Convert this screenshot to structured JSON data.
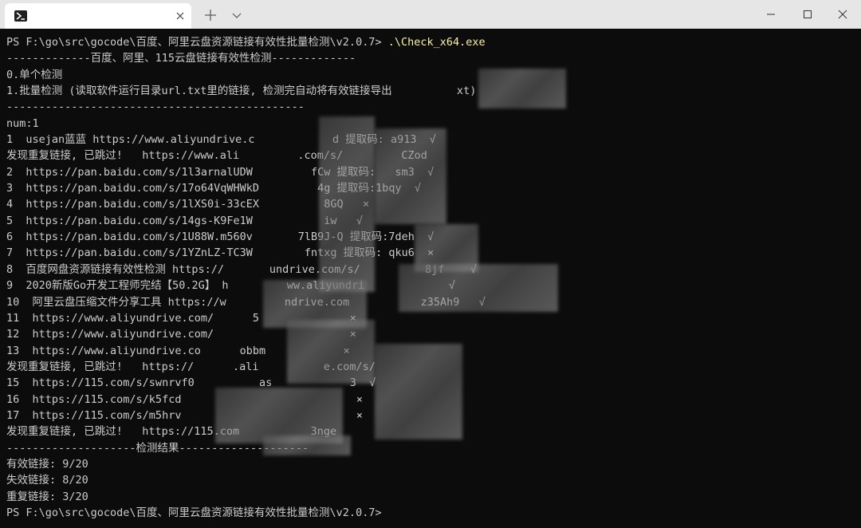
{
  "window": {
    "tab_title": "",
    "new_tab_glyph": "+",
    "dropdown_glyph": "⌄",
    "icons": [
      "powershell-icon",
      "close-icon",
      "plus-icon",
      "chevron-down-icon",
      "minimize-icon",
      "maximize-icon",
      "close-window-icon"
    ]
  },
  "terminal": {
    "prompt": "PS F:\\go\\src\\gocode\\百度、阿里云盘资源链接有效性批量检测\\v2.0.7>",
    "command": " .\\Check_x64.exe",
    "lines": [
      "-------------百度、阿里、115云盘链接有效性检测-------------",
      "0.单个检测",
      "1.批量检测 (读取软件运行目录url.txt里的链接, 检测完自动将有效链接导出          xt)",
      "----------------------------------------------",
      "num:1",
      "1  usejan蓝蓝 https://www.aliyundrive.c            d 提取码: a913  √",
      "发现重复链接, 已跳过!   https://www.ali         .com/s/         CZod",
      "2  https://pan.baidu.com/s/1l3arnalUDW         fCw 提取码:   sm3  √",
      "3  https://pan.baidu.com/s/17o64VqWHWkD         4g 提取码:1bqy  √",
      "4  https://pan.baidu.com/s/1lXS0i-33cEX          8GQ   ×",
      "5  https://pan.baidu.com/s/14gs-K9Fe1W           iw   √",
      "6  https://pan.baidu.com/s/1U88W.m560v       7lB9J-Q 提取码:7deh  √",
      "7  https://pan.baidu.com/s/1YZnLZ-TC3W        fntxg 提取码: qku6  ×",
      "8  百度网盘资源链接有效性检测 https://       undrive.com/s/          8jf    √",
      "9  2020新版Go开发工程师完结【50.2G】 h         ww.aliyundri             √",
      "10  阿里云盘压缩文件分享工具 https://w         ndrive.com           z35Ah9   √",
      "11  https://www.aliyundrive.com/      5              ×",
      "12  https://www.aliyundrive.com/                     ×",
      "13  https://www.aliyundrive.co      obbm            ×",
      "发现重复链接, 已跳过!   https://      .ali          e.com/s/",
      "15  https://115.com/s/swnrvf0          as            3  √",
      "16  https://115.com/s/k5fcd                           ×",
      "17  https://115.com/s/m5hrv                           ×",
      "发现重复链接, 已跳过!   https://115.com           3nge",
      "--------------------检测结果--------------------",
      "有效链接: 9/20",
      "失效链接: 8/20",
      "重复链接: 3/20"
    ],
    "final_prompt": "PS F:\\go\\src\\gocode\\百度、阿里云盘资源链接有效性批量检测\\v2.0.7>"
  }
}
